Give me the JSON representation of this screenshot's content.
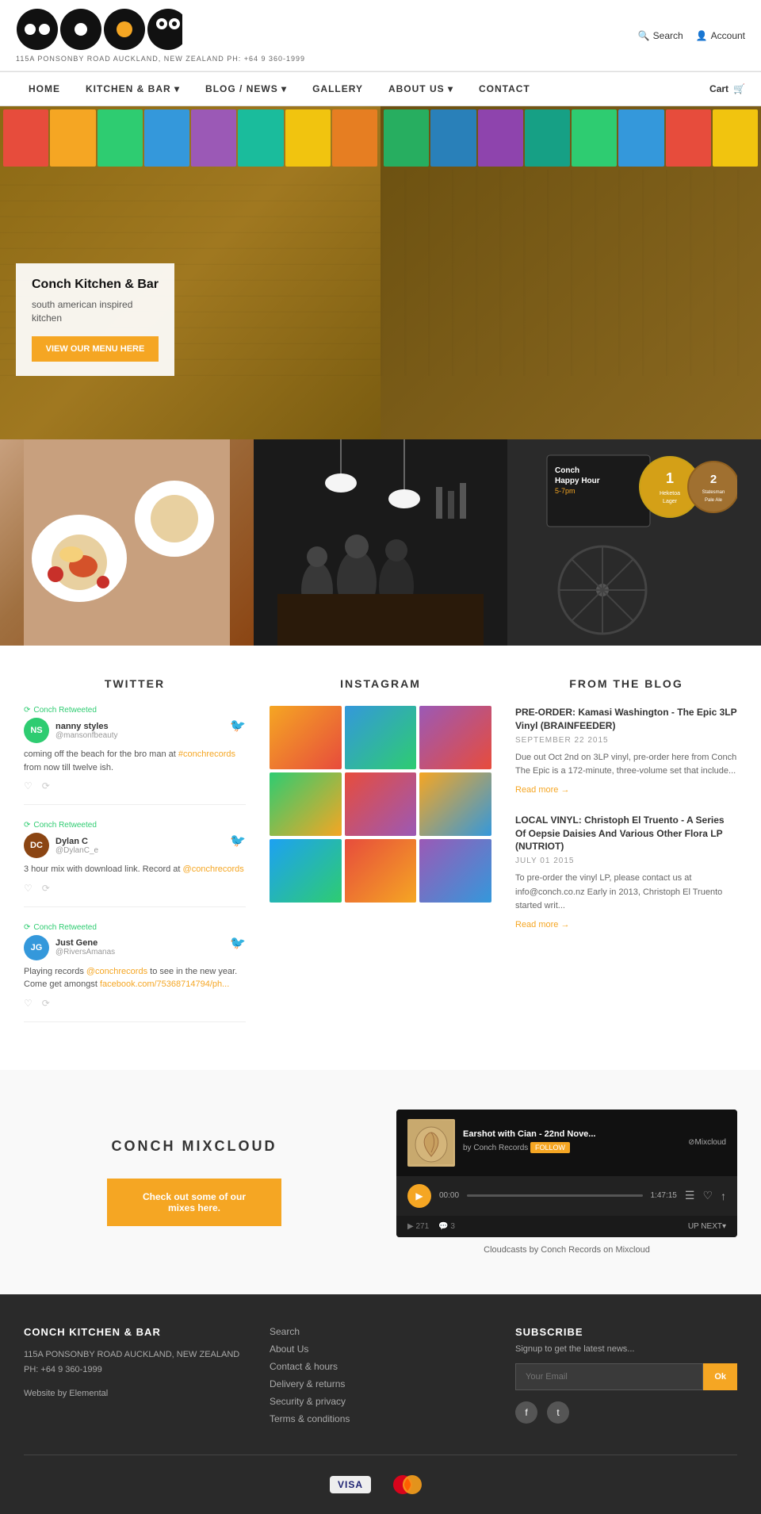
{
  "header": {
    "address": "115A PONSONBY ROAD   AUCKLAND, NEW ZEALAND   PH: +64 9 360-1999",
    "search_label": "Search",
    "account_label": "Account",
    "cart_label": "Cart"
  },
  "nav": {
    "items": [
      {
        "label": "HOME",
        "has_dropdown": false
      },
      {
        "label": "KITCHEN & BAR",
        "has_dropdown": true
      },
      {
        "label": "BLOG / NEWS",
        "has_dropdown": true
      },
      {
        "label": "GALLERY",
        "has_dropdown": false
      },
      {
        "label": "ABOUT US",
        "has_dropdown": true
      },
      {
        "label": "CONTACT",
        "has_dropdown": false
      }
    ]
  },
  "hero": {
    "title": "Conch Kitchen & Bar",
    "subtitle": "south american inspired kitchen",
    "btn_label": "view our menu here"
  },
  "twitter": {
    "section_title": "TWITTER",
    "tweets": [
      {
        "retweeted_by": "Conch Retweeted",
        "name": "nanny styles",
        "handle": "@mansonfbeauty",
        "text": "coming off the beach for the bro man at #conchrecords from now till twelve ish.",
        "avatar_initials": "NS"
      },
      {
        "retweeted_by": "Conch Retweeted",
        "name": "Dylan C",
        "handle": "@DylanC_e",
        "text": "3 hour mix with download link. Record at @conchrecords",
        "avatar_initials": "DC"
      },
      {
        "retweeted_by": "Conch Retweeted",
        "name": "Just Gene",
        "handle": "@RiversAmanas",
        "text": "Playing records @conchrecords to see in the new year. Come get amongst facebook.com/75368714794/ph...",
        "avatar_initials": "JG"
      }
    ]
  },
  "instagram": {
    "section_title": "INSTAGRAM"
  },
  "blog": {
    "section_title": "FROM THE BLOG",
    "posts": [
      {
        "title": "PRE-ORDER: Kamasi Washington - The Epic 3LP Vinyl (BRAINFEEDER)",
        "date": "SEPTEMBER 22 2015",
        "excerpt": "Due out Oct 2nd on 3LP vinyl, pre-order here from Conch The Epic is a 172-minute, three-volume set that include...",
        "read_more": "Read more →"
      },
      {
        "title": "LOCAL VINYL: Christoph El Truento - A Series Of Oepsie Daisies And Various Other Flora LP (NUTRIOT)",
        "date": "JULY 01 2015",
        "excerpt": "To pre-order the vinyl LP, please contact us at info@conch.co.nz Early in 2013, Christoph El Truento started writ...",
        "read_more": "Read more →"
      }
    ]
  },
  "mixcloud": {
    "section_title": "CONCH MIXCLOUD",
    "btn_label": "Check out some of our mixes here.",
    "player": {
      "track": "Earshot with Cian - 22nd Nove...",
      "artist": "by Conch Records",
      "follow_label": "FOLLOW",
      "logo": "⊘Mixcloud",
      "time_current": "00:00",
      "time_total": "1:47:15",
      "likes": "271",
      "comments": "3",
      "next_label": "UP NEXT▾"
    },
    "caption": "Cloudcasts by Conch Records on Mixcloud"
  },
  "footer": {
    "brand": "CONCH KITCHEN & BAR",
    "address_line1": "115A PONSONBY ROAD AUCKLAND, NEW ZEALAND",
    "address_line2": "PH: +64 9 360-1999",
    "website_credit": "Website by Elemental",
    "links": [
      "Search",
      "About Us",
      "Contact & hours",
      "Delivery & returns",
      "Security & privacy",
      "Terms & conditions"
    ],
    "subscribe_title": "SUBSCRIBE",
    "subscribe_text": "Signup to get the latest news...",
    "email_placeholder": "Your Email",
    "ok_label": "Ok",
    "social": [
      "f",
      "t"
    ]
  }
}
